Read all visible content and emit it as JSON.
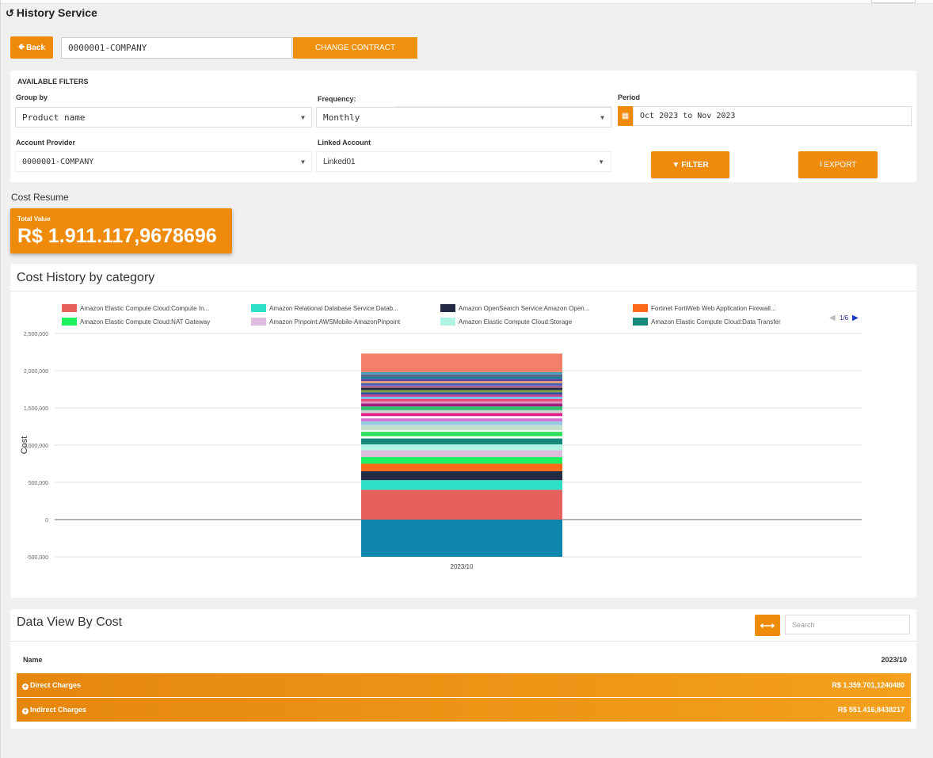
{
  "header": {
    "title": "History Service",
    "icon": "history-icon"
  },
  "contract": {
    "back_label": "Back",
    "value": "0000001-COMPANY",
    "change_label": "CHANGE CONTRACT"
  },
  "filters": {
    "section_title": "AVAILABLE FILTERS",
    "group_by": {
      "label": "Group by",
      "value": "Product name"
    },
    "frequency": {
      "label": "Frequency:",
      "value": "Monthly"
    },
    "period": {
      "label": "Period",
      "value": "Oct 2023 to Nov 2023"
    },
    "account_provider": {
      "label": "Account Provider",
      "value": "0000001-COMPANY"
    },
    "linked_account": {
      "label": "Linked Account",
      "value": "Linked01"
    },
    "filter_label": "FILTER",
    "export_label": "EXPORT"
  },
  "cost_resume": {
    "title": "Cost Resume",
    "total_label": "Total Value",
    "total_value": "R$ 1.911.117,9678696"
  },
  "chart": {
    "panel_title": "Cost History by category",
    "page_indicator": "1/6"
  },
  "chart_data": {
    "type": "bar",
    "stacked": true,
    "ylabel": "Cost",
    "xlabel": "",
    "ylim": [
      -500000,
      2500000
    ],
    "yticks": [
      "2,500,000",
      "2,000,000",
      "1,500,000",
      "1,000,000",
      "500,000",
      "0",
      "-500,000"
    ],
    "categories": [
      "2023/10"
    ],
    "legend": [
      {
        "name": "Amazon Elastic Compute Cloud:Compute In...",
        "color": "#e8605e"
      },
      {
        "name": "Amazon Relational Database Service:Datab...",
        "color": "#2ee0c8"
      },
      {
        "name": "Amazon OpenSearch Service:Amazon Open...",
        "color": "#222a44"
      },
      {
        "name": "Fortinet FortiWeb Web Application Firewall...",
        "color": "#ff6a1a"
      },
      {
        "name": "Amazon Elastic Compute Cloud:NAT Gateway",
        "color": "#1ef060"
      },
      {
        "name": "Amazon Pinpoint:AWSMobile-AmazonPinpoint",
        "color": "#dcbbdc"
      },
      {
        "name": "Amazon Elastic Compute Cloud:Storage",
        "color": "#b0f4e4"
      },
      {
        "name": "Amazon Elastic Compute Cloud:Data Transfer",
        "color": "#168a78"
      }
    ],
    "negative_segment": {
      "value": -500000,
      "color": "#0e86b0"
    },
    "segments": [
      {
        "value": 400000,
        "color": "#e8605e"
      },
      {
        "value": 130000,
        "color": "#2ee0c8"
      },
      {
        "value": 120000,
        "color": "#222a44"
      },
      {
        "value": 100000,
        "color": "#ff6a1a"
      },
      {
        "value": 90000,
        "color": "#1ef060"
      },
      {
        "value": 90000,
        "color": "#dcbbdc"
      },
      {
        "value": 80000,
        "color": "#b0f4e4"
      },
      {
        "value": 80000,
        "color": "#168a78"
      },
      {
        "value": 30000,
        "color": "#ffffff"
      },
      {
        "value": 60000,
        "color": "#2ee05a"
      },
      {
        "value": 20000,
        "color": "#ffffff"
      },
      {
        "value": 70000,
        "color": "#c0e0cc"
      },
      {
        "value": 50000,
        "color": "#9ac8e0"
      },
      {
        "value": 40000,
        "color": "#d070d0"
      },
      {
        "value": 30000,
        "color": "#ffffff"
      },
      {
        "value": 40000,
        "color": "#e01a8a"
      },
      {
        "value": 40000,
        "color": "#d0d0d0"
      },
      {
        "value": 50000,
        "color": "#30c070"
      },
      {
        "value": 40000,
        "color": "#a02080"
      },
      {
        "value": 30000,
        "color": "#e090c0"
      },
      {
        "value": 30000,
        "color": "#f04070"
      },
      {
        "value": 30000,
        "color": "#70c0f0"
      },
      {
        "value": 30000,
        "color": "#c04090"
      },
      {
        "value": 30000,
        "color": "#3050a0"
      },
      {
        "value": 30000,
        "color": "#80a040"
      },
      {
        "value": 30000,
        "color": "#222a44"
      },
      {
        "value": 30000,
        "color": "#b06090"
      },
      {
        "value": 30000,
        "color": "#4060c0"
      },
      {
        "value": 30000,
        "color": "#e0a070"
      },
      {
        "value": 30000,
        "color": "#6040a0"
      },
      {
        "value": 30000,
        "color": "#2080a0"
      },
      {
        "value": 30000,
        "color": "#606080"
      },
      {
        "value": 30000,
        "color": "#40a0c0"
      },
      {
        "value": 250000,
        "color": "#f4806a"
      }
    ]
  },
  "data_view": {
    "title": "Data View By Cost",
    "search_placeholder": "Search",
    "col_name": "Name",
    "col_period": "2023/10",
    "rows": [
      {
        "name": "Direct Charges",
        "value": "R$ 1.359.701,1240480"
      },
      {
        "name": "Indirect Charges",
        "value": "R$ 551.416,8438217"
      }
    ]
  }
}
